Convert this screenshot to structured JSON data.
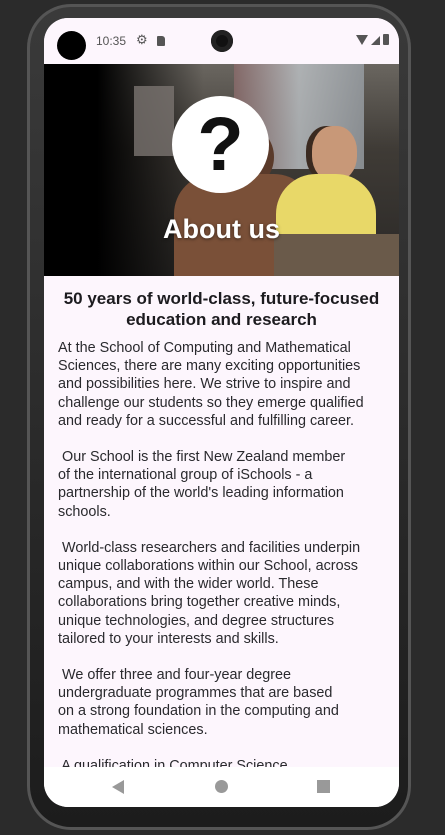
{
  "status_bar": {
    "time": "10:35"
  },
  "hero": {
    "title": "About us",
    "icon": "question-mark-icon"
  },
  "content": {
    "heading": "50 years of world-class, future-focused\neducation and research",
    "paragraphs": [
      "At the School of Computing and Mathematical\nSciences, there are many exciting opportunities\nand possibilities here. We strive to inspire and\nchallenge our students so they emerge qualified\nand ready for a successful and fulfilling career.",
      " Our School is the first New Zealand member\nof the international group of iSchools - a\npartnership of the world's leading information\nschools.",
      " World-class researchers and facilities underpin\nunique collaborations within our School, across\ncampus, and with the wider world. These\ncollaborations bring together creative minds,\nunique technologies, and degree structures\ntailored to your interests and skills.",
      " We offer three and four-year degree\nundergraduate programmes that are based\non a strong foundation in the computing and\nmathematical sciences.",
      " A qualification in Computer Science"
    ]
  }
}
